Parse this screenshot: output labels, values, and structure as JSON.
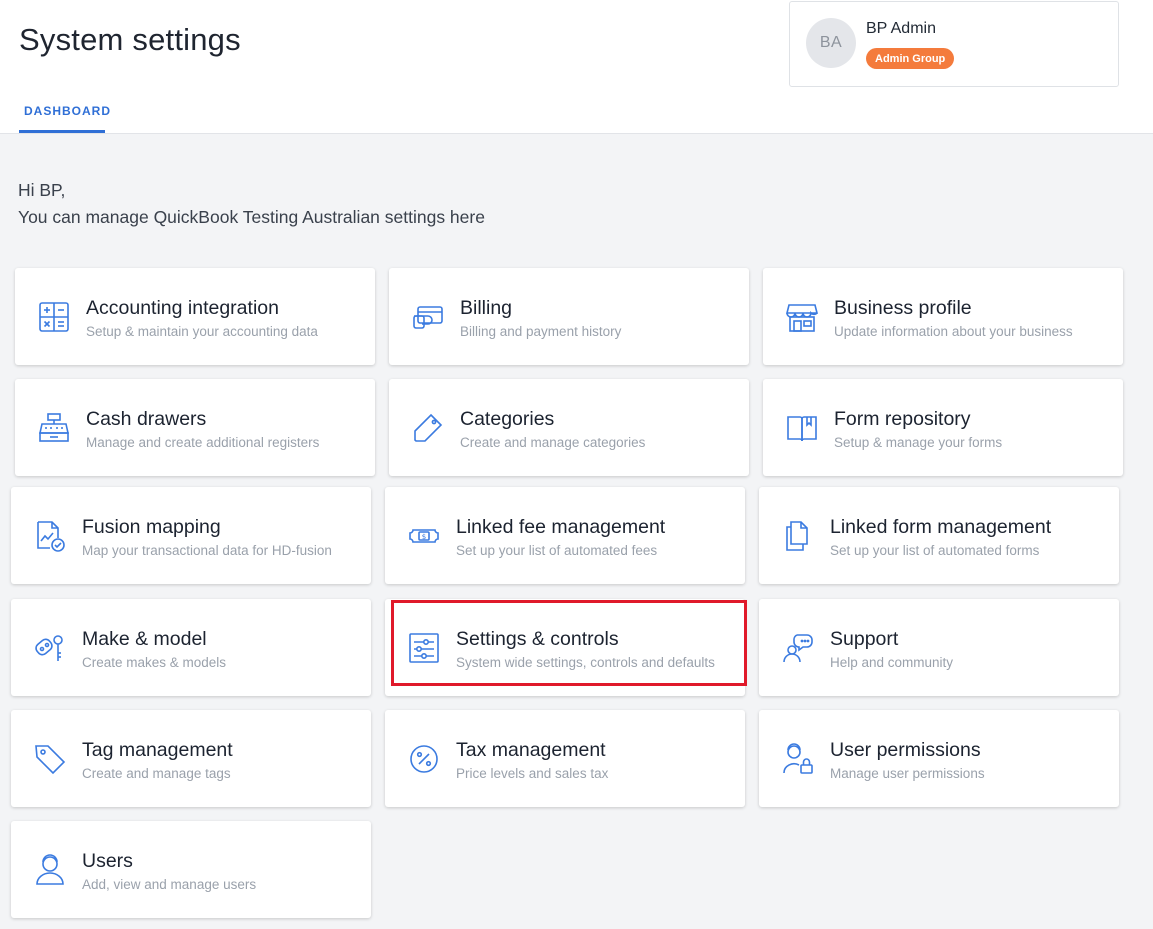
{
  "header": {
    "title": "System settings",
    "tab": "DASHBOARD"
  },
  "user": {
    "initials": "BA",
    "name": "BP Admin",
    "group": "Admin Group"
  },
  "greeting": {
    "line1": "Hi BP,",
    "line2": "You can manage QuickBook Testing Australian settings here"
  },
  "tiles": [
    {
      "title": "Accounting integration",
      "subtitle": "Setup & maintain your accounting data",
      "icon": "calculator-icon"
    },
    {
      "title": "Billing",
      "subtitle": "Billing and payment history",
      "icon": "credit-card-icon"
    },
    {
      "title": "Business profile",
      "subtitle": "Update information about your business",
      "icon": "storefront-icon"
    },
    {
      "title": "Cash drawers",
      "subtitle": "Manage and create additional registers",
      "icon": "cash-register-icon"
    },
    {
      "title": "Categories",
      "subtitle": "Create and manage categories",
      "icon": "tag-outline-icon"
    },
    {
      "title": "Form repository",
      "subtitle": "Setup & manage your forms",
      "icon": "book-icon"
    },
    {
      "title": "Fusion mapping",
      "subtitle": "Map your transactional data for HD-fusion",
      "icon": "chart-check-icon"
    },
    {
      "title": "Linked fee management",
      "subtitle": "Set up your list of automated fees",
      "icon": "money-bill-icon"
    },
    {
      "title": "Linked form management",
      "subtitle": "Set up your list of automated forms",
      "icon": "documents-icon"
    },
    {
      "title": "Make & model",
      "subtitle": "Create makes & models",
      "icon": "car-keys-icon"
    },
    {
      "title": "Settings & controls",
      "subtitle": "System wide settings, controls and defaults",
      "icon": "sliders-icon"
    },
    {
      "title": "Support",
      "subtitle": "Help and community",
      "icon": "support-chat-icon"
    },
    {
      "title": "Tag management",
      "subtitle": "Create and manage tags",
      "icon": "tag-icon"
    },
    {
      "title": "Tax management",
      "subtitle": "Price levels and sales tax",
      "icon": "percent-icon"
    },
    {
      "title": "User permissions",
      "subtitle": "Manage user permissions",
      "icon": "user-lock-icon"
    },
    {
      "title": "Users",
      "subtitle": "Add, view and manage users",
      "icon": "user-icon"
    }
  ],
  "colors": {
    "accent": "#2f6fd6",
    "icon": "#3b7be0",
    "badge": "#f47b3c",
    "highlight": "#e0192a"
  }
}
